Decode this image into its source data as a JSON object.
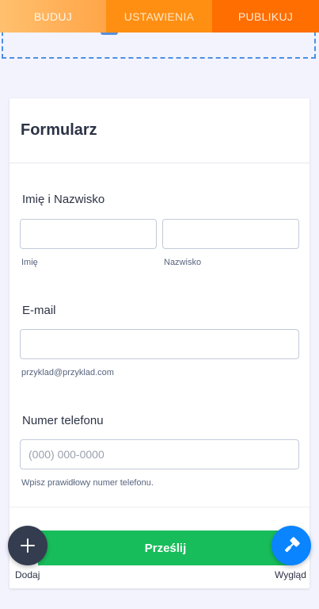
{
  "tabs": [
    {
      "label": "BUDUJ"
    },
    {
      "label": "USTAWIENIA"
    },
    {
      "label": "PUBLIKUJ"
    }
  ],
  "form": {
    "title": "Formularz",
    "name_field": {
      "label": "Imię i Nazwisko",
      "first_sublabel": "Imię",
      "last_sublabel": "Nazwisko",
      "first_value": "",
      "last_value": ""
    },
    "email_field": {
      "label": "E-mail",
      "value": "",
      "sublabel": "przyklad@przyklad.com"
    },
    "phone_field": {
      "label": "Numer telefonu",
      "placeholder": "(000) 000-0000",
      "sublabel": "Wpisz prawidłowy numer telefonu."
    },
    "submit_label": "Prześlij"
  },
  "fabs": {
    "add_label": "Dodaj",
    "style_label": "Wygląd"
  },
  "colors": {
    "accent_orange": "#ff6a00",
    "submit_green": "#18bd5b",
    "fab_dark": "#343c4f",
    "fab_blue": "#0a84ff"
  }
}
